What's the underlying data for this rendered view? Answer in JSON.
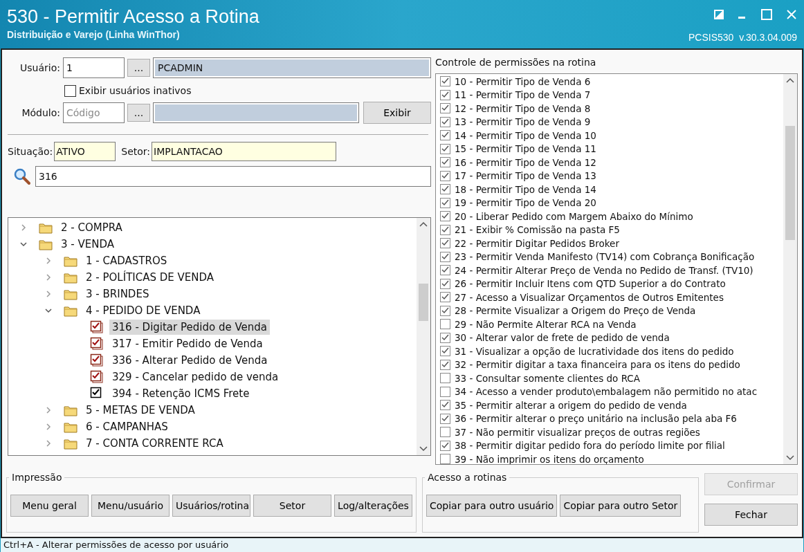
{
  "window": {
    "title": "530 - Permitir Acesso a Rotina",
    "subtitle": "Distribuição e Varejo (Linha WinThor)",
    "version": "PCSIS530  v.30.3.04.009"
  },
  "user": {
    "label": "Usuário:",
    "code": "1",
    "lookup": "...",
    "name": "PCADMIN"
  },
  "show_inactive": {
    "label": "Exibir usuários inativos",
    "checked": false
  },
  "module": {
    "label": "Módulo:",
    "placeholder": "Código",
    "lookup": "...",
    "button": "Exibir"
  },
  "situation": {
    "label": "Situação:",
    "value": "ATIVO"
  },
  "sector": {
    "label": "Setor:",
    "value": "IMPLANTACAO"
  },
  "search": {
    "value": "316"
  },
  "tree": [
    {
      "kind": "folder",
      "label": "2 - COMPRA",
      "expanded": false,
      "selected": false
    },
    {
      "kind": "folder",
      "label": "3 - VENDA",
      "expanded": true,
      "selected": false,
      "children": [
        {
          "kind": "folder",
          "label": "1 - CADASTROS",
          "expanded": false,
          "selected": false
        },
        {
          "kind": "folder",
          "label": "2 - POLÍTICAS DE VENDA",
          "expanded": false,
          "selected": false
        },
        {
          "kind": "folder",
          "label": "3 - BRINDES",
          "expanded": false,
          "selected": false
        },
        {
          "kind": "folder",
          "label": "4 - PEDIDO DE VENDA",
          "expanded": true,
          "selected": false,
          "children": [
            {
              "kind": "routine-set",
              "label": "316 - Digitar Pedido de Venda",
              "checked": true,
              "selected": true
            },
            {
              "kind": "routine-set",
              "label": "317 - Emitir Pedido de Venda",
              "checked": true,
              "selected": false
            },
            {
              "kind": "routine-set",
              "label": "336 - Alterar Pedido de Venda",
              "checked": true,
              "selected": false
            },
            {
              "kind": "routine-set",
              "label": "329 - Cancelar pedido de venda",
              "checked": true,
              "selected": false
            },
            {
              "kind": "routine",
              "label": "394 - Retenção ICMS Frete",
              "checked": true,
              "selected": false
            }
          ]
        },
        {
          "kind": "folder",
          "label": "5 - METAS DE VENDA",
          "expanded": false,
          "selected": false
        },
        {
          "kind": "folder",
          "label": "6 - CAMPANHAS",
          "expanded": false,
          "selected": false
        },
        {
          "kind": "folder",
          "label": "7 - CONTA CORRENTE RCA",
          "expanded": false,
          "selected": false
        }
      ]
    }
  ],
  "permissions": {
    "title": "Controle de permissões na rotina",
    "items": [
      {
        "label": "10 - Permitir Tipo de Venda 6",
        "checked": true
      },
      {
        "label": "11 - Permitir Tipo de Venda 7",
        "checked": true
      },
      {
        "label": "12 - Permitir Tipo de Venda 8",
        "checked": true
      },
      {
        "label": "13 - Permitir Tipo de Venda 9",
        "checked": true
      },
      {
        "label": "14 - Permitir Tipo de Venda 10",
        "checked": true
      },
      {
        "label": "15 - Permitir Tipo de Venda 11",
        "checked": true
      },
      {
        "label": "16 - Permitir Tipo de Venda 12",
        "checked": true
      },
      {
        "label": "17 - Permitir Tipo de Venda 13",
        "checked": true
      },
      {
        "label": "18 - Permitir Tipo de Venda 14",
        "checked": true
      },
      {
        "label": "19 - Permitir Tipo de Venda 20",
        "checked": true
      },
      {
        "label": "20 - Liberar Pedido com Margem Abaixo do Mínimo",
        "checked": true
      },
      {
        "label": "21 - Exibir % Comissão na pasta F5",
        "checked": true
      },
      {
        "label": "22 - Permitir Digitar Pedidos Broker",
        "checked": true
      },
      {
        "label": "23 - Permitir Venda Manifesto (TV14) com Cobrança Bonificação",
        "checked": true
      },
      {
        "label": "24 - Permitir Alterar Preço de Venda no Pedido de Transf. (TV10)",
        "checked": true
      },
      {
        "label": "26 - Permitir Incluir Itens com QTD Superior a do Contrato",
        "checked": true
      },
      {
        "label": "27 - Acesso a Visualizar Orçamentos de Outros Emitentes",
        "checked": true
      },
      {
        "label": "28 - Permite Visualizar a Origem do Preço de Venda",
        "checked": true
      },
      {
        "label": "29 - Não Permite Alterar RCA na Venda",
        "checked": false
      },
      {
        "label": "30 - Alterar valor de frete de pedido de venda",
        "checked": true
      },
      {
        "label": "31 - Visualizar a opção de lucratividade dos itens do pedido",
        "checked": true
      },
      {
        "label": "32 - Permitir digitar a taxa financeira para os itens do pedido",
        "checked": true
      },
      {
        "label": "33 - Consultar somente clientes do RCA",
        "checked": false
      },
      {
        "label": "34 - Acesso a vender produto\\embalagem não permitido no atac",
        "checked": false
      },
      {
        "label": "35 - Permitir alterar a origem do pedido de venda",
        "checked": true
      },
      {
        "label": "36 - Permitir alterar o preço unitário na inclusão pela aba F6",
        "checked": true
      },
      {
        "label": "37 - Não permitir visualizar preços de outras regiões",
        "checked": false
      },
      {
        "label": "38 - Permitir digitar pedido fora do período limite por filial",
        "checked": true
      },
      {
        "label": "39 - Não imprimir os itens do orçamento",
        "checked": false
      }
    ]
  },
  "print_group": {
    "title": "Impressão",
    "buttons": [
      "Menu geral",
      "Menu/usuário",
      "Usuários/rotina",
      "Setor",
      "Log/alterações"
    ]
  },
  "access_group": {
    "title": "Acesso a rotinas",
    "buttons": [
      "Copiar para outro usuário",
      "Copiar para outro Setor"
    ]
  },
  "actions": [
    {
      "label": "Confirmar",
      "disabled": true
    },
    {
      "label": "Fechar",
      "disabled": false
    }
  ],
  "status_bar": "Ctrl+A - Alterar permissões de acesso por usuário"
}
